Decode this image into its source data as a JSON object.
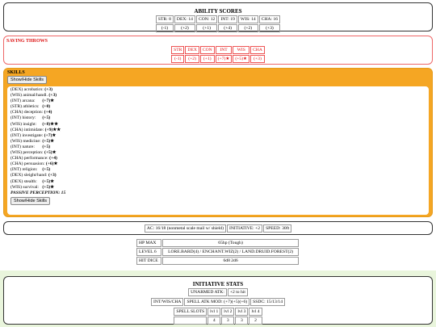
{
  "ability_scores": {
    "title": "ABILITY SCORES",
    "scores": [
      "STR: 8",
      "DEX: 14",
      "CON: 12",
      "INT: 19",
      "WIS: 14",
      "CHA: 16"
    ],
    "mods": [
      "(-1)",
      "(+2)",
      "(+1)",
      "(+4)",
      "(+2)",
      "(+3)"
    ]
  },
  "saving_throws": {
    "title": "SAVING THROWS",
    "heads": [
      "STR",
      "DEX",
      "CON",
      "INT",
      "WIS",
      "CHA"
    ],
    "mods": [
      "(-1)",
      "(+2)",
      "(+1)",
      "(+7)★",
      "(+5)★",
      "(+3)"
    ]
  },
  "skills": {
    "title": "SKILLS",
    "toggle_label": "Show/Hide Skills",
    "items": [
      {
        "name": "(DEX) acrobatics:",
        "val": "(+3)"
      },
      {
        "name": "(WIS) animal/handl.",
        "val": "(+3)"
      },
      {
        "name": "(INT) arcana:",
        "val": "(+7)★"
      },
      {
        "name": "(STR) athletics:",
        "val": "(+0)"
      },
      {
        "name": "(CHA) deception:",
        "val": "(+4)"
      },
      {
        "name": "(INT) history:",
        "val": "(+5)"
      },
      {
        "name": "(WIS) insight:",
        "val": "(+8)★★"
      },
      {
        "name": "(CHA) intimidate:",
        "val": "(+9)★★"
      },
      {
        "name": "(INT) investigate:",
        "val": "(+7)★"
      },
      {
        "name": "(WIS) medicine:",
        "val": "(+5)★"
      },
      {
        "name": "(INT) nature:",
        "val": "(+5)"
      },
      {
        "name": "(WIS) perception:",
        "val": "(+5)★"
      },
      {
        "name": "(CHA) performance:",
        "val": "(+4)"
      },
      {
        "name": "(CHA) persuasion:",
        "val": "(+6)★"
      },
      {
        "name": "(INT) religion:",
        "val": "(+5)"
      },
      {
        "name": "(DEX) sleight/hand:",
        "val": "(+3)"
      },
      {
        "name": "(DEX) stealth:",
        "val": "(+5)★"
      },
      {
        "name": "(WIS) survival:",
        "val": "(+5)★"
      }
    ],
    "passive": "PASSIVE PERCEPTION: 15"
  },
  "combat": {
    "ac": "AC: 16/18 (nonmetal scale mail w/ shield)",
    "initiative": "INITIATIVE: +2",
    "speed": "SPEED: 30ft"
  },
  "info": {
    "hp_label": "HP MAX",
    "hp_value": "65hp (Tough)",
    "level_label": "LEVEL 6",
    "level_value": "LORE.BARD(4) / ENCHANT.WIZ(2) / LAND.DRUID.FOREST(2)",
    "hd_label": "HIT DICE",
    "hd_value": "6d8 2d6"
  },
  "initiative_stats": {
    "title": "INITIATIVE STATS",
    "unarmed_label": "UNARMED ATK:",
    "unarmed_value": "+2 to hit",
    "int_wis_cha": "INT/WIS/CHA",
    "spell_atk": "SPELL ATK MOD: (+7)(+5)(+6)",
    "ssdc": "SSDC: 15/13/14",
    "slots_label": "SPELL SLOTS",
    "slot_levels": [
      "lvl 1",
      "lvl 2",
      "lvl 3",
      "lvl 4"
    ],
    "slot_counts": [
      "4",
      "3",
      "3",
      "2"
    ]
  },
  "colors": {
    "skills_accent": "#f5a623",
    "saving_red": "#dd1111",
    "bottom_band": "#e9f5dc"
  }
}
